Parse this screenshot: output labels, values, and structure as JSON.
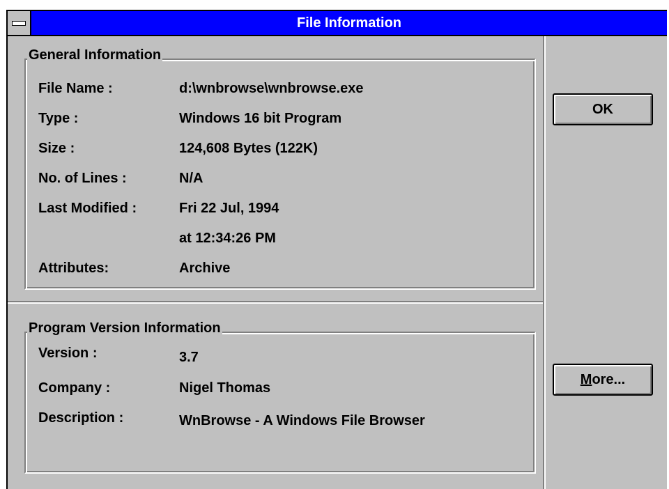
{
  "window": {
    "title": "File Information"
  },
  "general": {
    "heading": "General Information",
    "rows": [
      {
        "label": "File Name :",
        "value": "d:\\wnbrowse\\wnbrowse.exe"
      },
      {
        "label": "Type :",
        "value": "Windows 16 bit Program"
      },
      {
        "label": "Size :",
        "value": "124,608 Bytes (122K)"
      },
      {
        "label": "No. of Lines :",
        "value": "N/A"
      },
      {
        "label": "Last Modified :",
        "value": "Fri 22 Jul, 1994",
        "value2": "at 12:34:26 PM"
      },
      {
        "label": "Attributes:",
        "value": "Archive"
      }
    ]
  },
  "version": {
    "heading": "Program Version Information",
    "rows": [
      {
        "label": "Version :",
        "value": "3.7"
      },
      {
        "label": "Company :",
        "value": "Nigel Thomas"
      },
      {
        "label": "Description :",
        "value": "WnBrowse - A Windows File Browser"
      }
    ]
  },
  "buttons": {
    "ok_label": "OK",
    "more_mnemonic": "M",
    "more_rest": "ore..."
  },
  "colors": {
    "titlebar": "#0000ff",
    "face": "#c0c0c0"
  }
}
